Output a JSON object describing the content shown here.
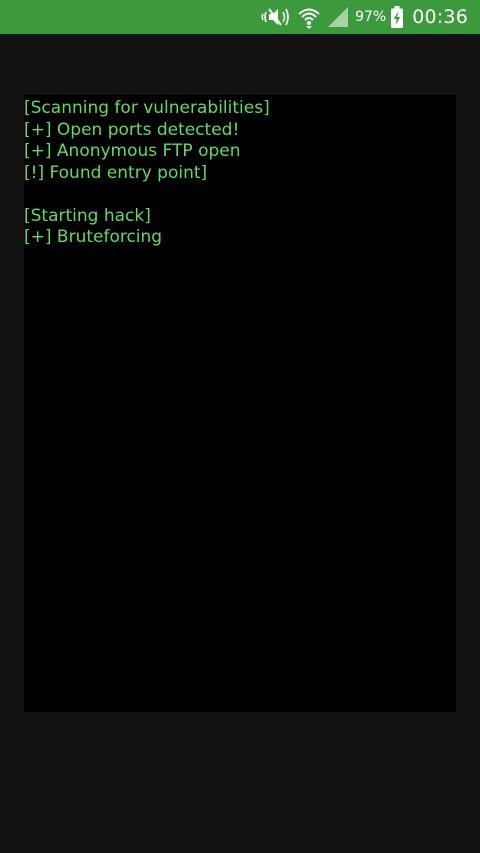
{
  "status_bar": {
    "battery_percent": "97%",
    "time": "00:36",
    "icons": [
      "mute-icon",
      "wifi-icon",
      "signal-icon",
      "battery-charging-icon"
    ]
  },
  "colors": {
    "status_bar": "#3c9a3c",
    "background": "#121212",
    "terminal": "#000000",
    "terminal_text": "#5fdc5f"
  },
  "terminal": {
    "lines": [
      "[Scanning for vulnerabilities]",
      "[+] Open ports detected!",
      "[+] Anonymous FTP open",
      "[!] Found entry point]",
      "",
      "[Starting hack]",
      "[+] Bruteforcing"
    ]
  }
}
